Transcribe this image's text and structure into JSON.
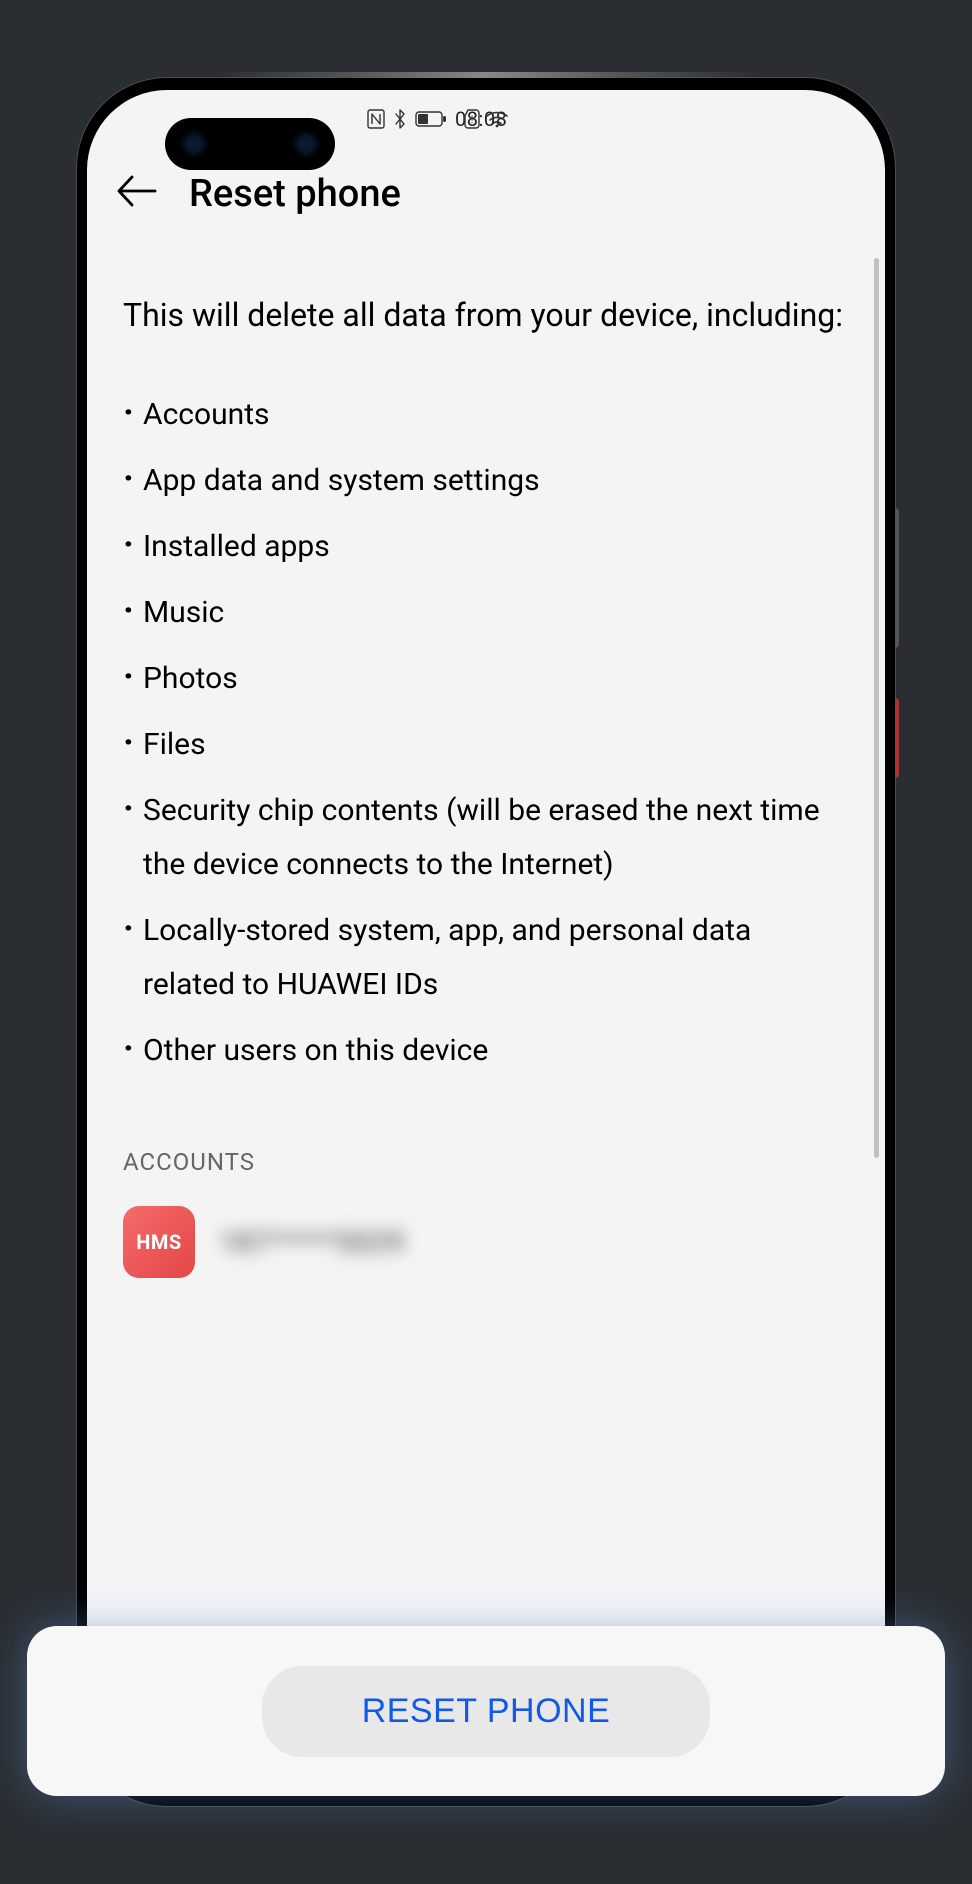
{
  "status": {
    "time": "08:08"
  },
  "header": {
    "title": "Reset phone"
  },
  "content": {
    "intro": "This will delete all data from your device, including:",
    "bullets": {
      "b0": "Accounts",
      "b1": "App data and system settings",
      "b2": "Installed apps",
      "b3": "Music",
      "b4": "Photos",
      "b5": "Files",
      "b6": "Security chip contents (will be erased the next time the device connects to the Internet)",
      "b7": "Locally-stored system, app, and personal data related to HUAWEI IDs",
      "b8": "Other users on this device"
    },
    "section_label": "ACCOUNTS",
    "account": {
      "icon_label": "HMS",
      "id": "187*****5029"
    }
  },
  "footer": {
    "reset_button": "RESET PHONE"
  }
}
